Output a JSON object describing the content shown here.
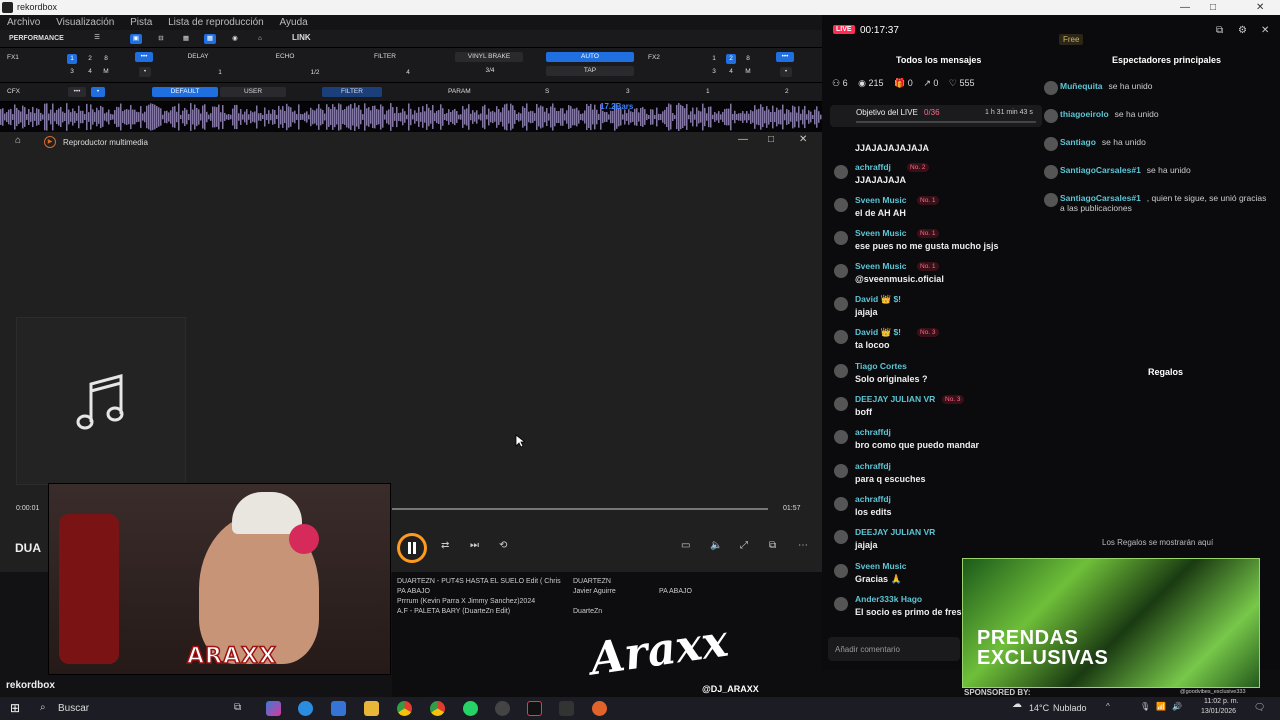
{
  "window": {
    "title": "rekordbox",
    "controls": [
      "—",
      "□",
      "✕"
    ]
  },
  "menubar": [
    "Archivo",
    "Visualización",
    "Pista",
    "Lista de reproducción",
    "Ayuda"
  ],
  "rekordbox": {
    "mode": "PERFORMANCE",
    "link": "LINK",
    "fx1": {
      "label": "FX1",
      "beats": [
        "1",
        "2",
        "8",
        "3",
        "4",
        "M"
      ],
      "effects": [
        "DELAY",
        "ECHO",
        "FILTER",
        "VINYL BRAKE"
      ],
      "values": [
        "1",
        "1/2",
        "4",
        "3/4"
      ],
      "auto": "AUTO",
      "tap": "TAP"
    },
    "fx2": {
      "label": "FX2",
      "beats": [
        "1",
        "2",
        "8",
        "3",
        "4",
        "M"
      ]
    },
    "cfx": {
      "label": "CFX",
      "default_label": "DEFAULT",
      "user_label": "USER",
      "filter_label": "FILTER",
      "param_label": "PARAM",
      "values": [
        "S",
        "3",
        "1",
        "2"
      ]
    },
    "wave_label": "17.2Bars"
  },
  "player": {
    "title": "Reproductor multimedia",
    "time_elapsed": "0:00:01",
    "time_total": "01:57",
    "progress": 0.02,
    "now_playing_short": "DUA",
    "music_icon": "music-note-icon"
  },
  "tracks": [
    {
      "title": "DUARTEZN - PUT4S HASTA EL SUELO Edit ( Chris",
      "artist": "DUARTEZN",
      "album": ""
    },
    {
      "title": "PA ABAJO",
      "artist": "Javier Aguirre",
      "album": "PA ABAJO"
    },
    {
      "title": "Prrrum (Kevin Parra X Jimmy Sanchez)2024",
      "artist": "",
      "album": ""
    },
    {
      "title": "A.F - PALETA BARY (DuarteZn Edit)",
      "artist": "DuarteZn",
      "album": ""
    }
  ],
  "live": {
    "badge": "LIVE",
    "timer": "00:17:37",
    "plan": "Free",
    "tab_messages": "Todos los mensajes",
    "tab_viewers": "Espectadores principales",
    "stats": {
      "viewers": "6",
      "views": "215",
      "gifts": "0",
      "shares": "0",
      "likes": "555"
    },
    "goal": {
      "label": "Objetivo del LIVE",
      "progress": "0/36",
      "remaining": "1 h 31 min 43 s"
    },
    "messages": [
      {
        "user": "",
        "badge": "",
        "text": "JJAJAJAJAJAJA"
      },
      {
        "user": "achraffdj",
        "badge": "No. 2",
        "text": "JJAJAJAJA"
      },
      {
        "user": "Sveen Music",
        "badge": "No. 1",
        "text": "el de AH AH"
      },
      {
        "user": "Sveen Music",
        "badge": "No. 1",
        "text": "ese pues no me gusta mucho jsjs"
      },
      {
        "user": "Sveen Music",
        "badge": "No. 1",
        "text": "@sveenmusic.oficial"
      },
      {
        "user": "David 👑 $!",
        "badge": "",
        "text": "jajaja"
      },
      {
        "user": "David 👑 $!",
        "badge": "No. 3",
        "text": "ta locoo"
      },
      {
        "user": "Tiago Cortes",
        "badge": "",
        "text": "Solo originales ?"
      },
      {
        "user": "DEEJAY JULIAN VR",
        "badge": "No. 3",
        "text": "boff"
      },
      {
        "user": "achraffdj",
        "badge": "",
        "text": "bro como que puedo mandar"
      },
      {
        "user": "achraffdj",
        "badge": "",
        "text": "para q escuches"
      },
      {
        "user": "achraffdj",
        "badge": "",
        "text": "los edits"
      },
      {
        "user": "DEEJAY JULIAN VR",
        "badge": "",
        "text": "jajaja"
      },
      {
        "user": "Sveen Music",
        "badge": "",
        "text": "Gracias 🙏"
      },
      {
        "user": "Ander333k Hago",
        "badge": "",
        "text": "El socio es primo de fres"
      }
    ],
    "joins": [
      {
        "user": "Muñequita",
        "text": "se ha unido"
      },
      {
        "user": "thiagoeirolo",
        "text": "se ha unido"
      },
      {
        "user": "Santiago",
        "text": "se ha unido"
      },
      {
        "user": "SantiagoCarsales#1",
        "text": "se ha unido"
      },
      {
        "user": "SantiagoCarsales#1",
        "text": ", quien te sigue, se unió gracias a las publicaciones"
      }
    ],
    "gifts_title": "Regalos",
    "gifts_empty": "Los Regalos se mostrarán aquí",
    "comment_placeholder": "Añadir comentario"
  },
  "overlay": {
    "promo_line1": "PRENDAS",
    "promo_line2": "EXCLUSIVAS",
    "sponsored": "SPONSORED BY:",
    "sponsor_handle": "@goodvibes_exclusive333",
    "signature": "Araxx",
    "instagram": "@DJ_ARAXX",
    "cam_logo": "ARAXX",
    "rekordbox_brand": "rekordbox"
  },
  "taskbar": {
    "search": "Buscar",
    "weather_temp": "14°C",
    "weather_desc": "Nublado",
    "time": "11:02 p. m.",
    "date": "13/01/2026"
  },
  "colors": {
    "accent_blue": "#1f6fe0",
    "live_red": "#fe2c55",
    "chat_user": "#5dc6d6"
  }
}
